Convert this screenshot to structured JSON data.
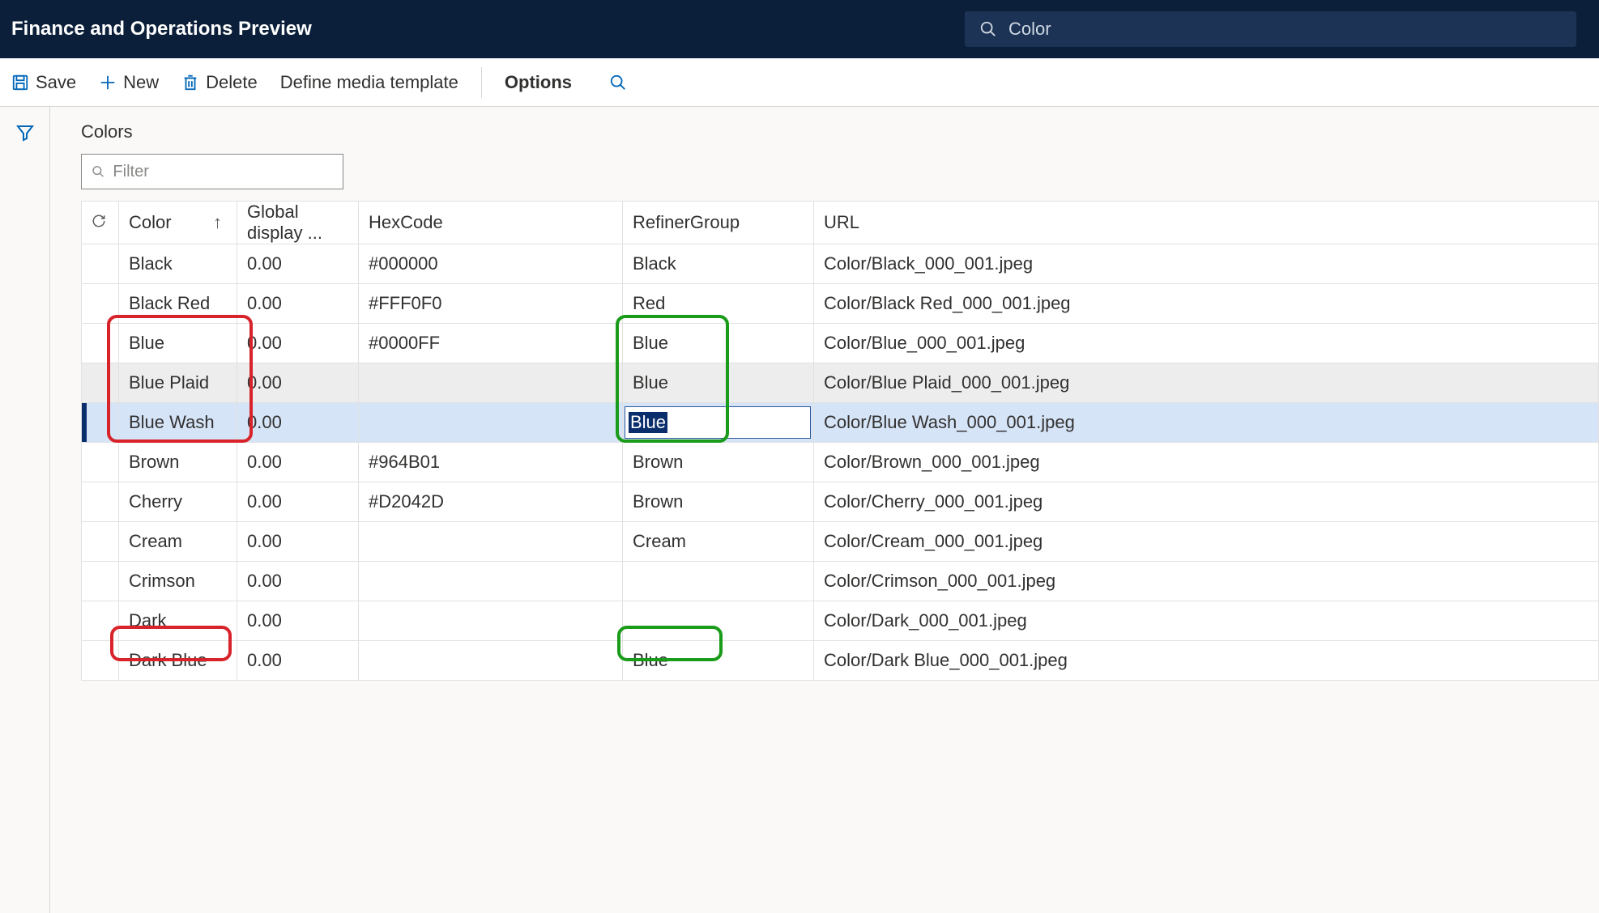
{
  "header": {
    "app_title": "Finance and Operations Preview",
    "search_value": "Color"
  },
  "commands": {
    "save": "Save",
    "new": "New",
    "delete": "Delete",
    "define_template": "Define media template",
    "options": "Options"
  },
  "page": {
    "title": "Colors",
    "filter_placeholder": "Filter"
  },
  "columns": {
    "color": "Color",
    "global_display": "Global display ...",
    "hexcode": "HexCode",
    "refiner_group": "RefinerGroup",
    "url": "URL"
  },
  "rows": [
    {
      "color": "Black",
      "display": "0.00",
      "hex": "#000000",
      "refiner": "Black",
      "url": "Color/Black_000_001.jpeg"
    },
    {
      "color": "Black Red",
      "display": "0.00",
      "hex": "#FFF0F0",
      "refiner": "Red",
      "url": "Color/Black Red_000_001.jpeg"
    },
    {
      "color": "Blue",
      "display": "0.00",
      "hex": "#0000FF",
      "refiner": "Blue",
      "url": "Color/Blue_000_001.jpeg"
    },
    {
      "color": "Blue Plaid",
      "display": "0.00",
      "hex": "",
      "refiner": "Blue",
      "url": "Color/Blue Plaid_000_001.jpeg"
    },
    {
      "color": "Blue Wash",
      "display": "0.00",
      "hex": "",
      "refiner": "Blue",
      "url": "Color/Blue Wash_000_001.jpeg"
    },
    {
      "color": "Brown",
      "display": "0.00",
      "hex": "#964B01",
      "refiner": "Brown",
      "url": "Color/Brown_000_001.jpeg"
    },
    {
      "color": "Cherry",
      "display": "0.00",
      "hex": "#D2042D",
      "refiner": "Brown",
      "url": "Color/Cherry_000_001.jpeg"
    },
    {
      "color": "Cream",
      "display": "0.00",
      "hex": "",
      "refiner": "Cream",
      "url": "Color/Cream_000_001.jpeg"
    },
    {
      "color": "Crimson",
      "display": "0.00",
      "hex": "",
      "refiner": "",
      "url": "Color/Crimson_000_001.jpeg"
    },
    {
      "color": "Dark",
      "display": "0.00",
      "hex": "",
      "refiner": "",
      "url": "Color/Dark_000_001.jpeg"
    },
    {
      "color": "Dark Blue",
      "display": "0.00",
      "hex": "",
      "refiner": "Blue",
      "url": "Color/Dark Blue_000_001.jpeg"
    }
  ]
}
